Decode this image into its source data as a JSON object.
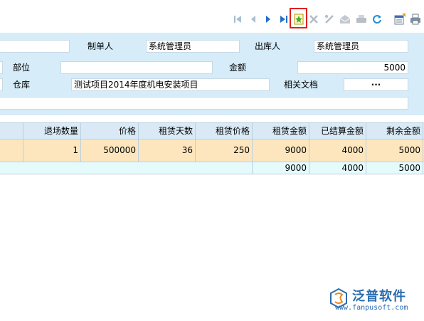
{
  "toolbar": {
    "icons": [
      "first-icon",
      "prev-icon",
      "next-icon",
      "last-icon",
      "add-icon",
      "delete-icon",
      "edit-icon",
      "approve-icon",
      "print-icon",
      "refresh-icon",
      "export-icon",
      "printer-icon"
    ]
  },
  "form": {
    "creator_label": "制单人",
    "creator_value": "系统管理员",
    "outbound_person_label": "出库人",
    "outbound_person_value": "系统管理员",
    "department_label": "部位",
    "department_value": "",
    "amount_label": "金额",
    "amount_value": "5000",
    "warehouse_label": "仓库",
    "warehouse_value": "测试项目2014年度机电安装项目",
    "docs_label": "相关文档",
    "docs_button": "···"
  },
  "grid": {
    "columns": [
      "退场数量",
      "价格",
      "租赁天数",
      "租赁价格",
      "租赁金额",
      "已结算金额",
      "剩余金额"
    ],
    "rows": [
      [
        "1",
        "500000",
        "36",
        "250",
        "9000",
        "4000",
        "5000"
      ]
    ],
    "summary": [
      "9000",
      "4000",
      "5000"
    ]
  },
  "watermark": {
    "brand": "泛普软件",
    "url": "www.fanpusoft.com"
  },
  "colors": {
    "form_bg": "#d6ecf9",
    "row_bg": "#fde6bd",
    "summary_bg": "#e5fbfb",
    "highlight": "#e02020",
    "brand": "#2a6db0"
  }
}
